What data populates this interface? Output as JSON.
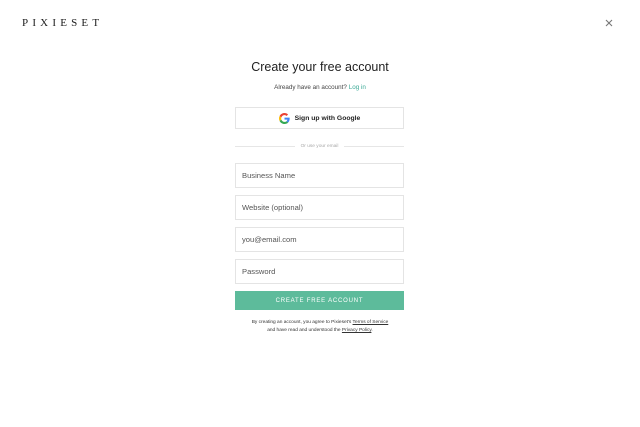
{
  "brand": {
    "logo_text": "PIXIESET"
  },
  "close": {
    "icon": "close-icon"
  },
  "header": {
    "title": "Create your free account"
  },
  "login": {
    "prompt": "Already have an account?",
    "link_label": "Log in"
  },
  "google": {
    "icon": "google-icon",
    "label": "Sign up with Google"
  },
  "divider": {
    "text": "Or use your email"
  },
  "form": {
    "business_name": {
      "value": "",
      "placeholder": "Business Name"
    },
    "website": {
      "value": "",
      "placeholder": "Website (optional)"
    },
    "email": {
      "value": "",
      "placeholder": "you@email.com"
    },
    "password": {
      "value": "",
      "placeholder": "Password"
    },
    "submit_label": "CREATE FREE ACCOUNT"
  },
  "terms": {
    "line1_prefix": "By creating an account, you agree to Pixieset's",
    "terms_link": "Terms of Service",
    "line2_prefix": "and have read and understood the",
    "privacy_link": "Privacy Policy",
    "line2_suffix": "."
  },
  "colors": {
    "accent": "#5dbb9b",
    "link": "#3aa895",
    "border": "#e4e4e4"
  }
}
